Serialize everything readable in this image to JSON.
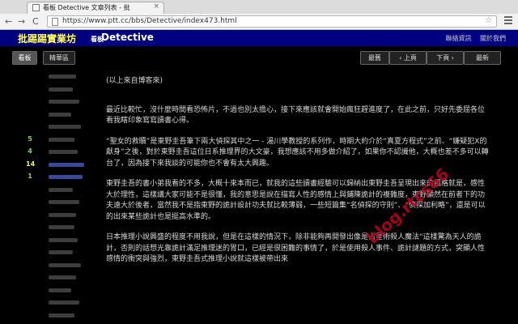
{
  "browser": {
    "tab_title": "看板 Detective 文章列表 - 批",
    "tab_close": "×",
    "url": "https://www.ptt.cc/bbs/Detective/index473.html",
    "back": "←",
    "forward": "→",
    "reload": "C",
    "star": "☆"
  },
  "header": {
    "site_name": "批踢踢實業坊",
    "board_label": "看板",
    "board_name": "Detective",
    "links": [
      "聯絡資訊",
      "關於我們"
    ]
  },
  "actions": {
    "board_tab": "看板",
    "digest_tab": "精華區",
    "oldest": "最舊",
    "prev": "‹ 上頁",
    "next": "下頁 ›",
    "newest": "最新"
  },
  "list": [
    {
      "push": "",
      "color": "#bbb",
      "w": 34
    },
    {
      "push": "",
      "color": "#bbb",
      "w": 30
    },
    {
      "push": "",
      "color": "#bbb",
      "w": 38
    },
    {
      "push": "",
      "color": "#bbb",
      "w": 28
    },
    {
      "push": "",
      "color": "#bbb",
      "w": 40
    },
    {
      "push": "5",
      "color": "#7fdc3c",
      "w": 32
    },
    {
      "push": "4",
      "color": "#7fdc3c",
      "w": 36
    },
    {
      "push": "14",
      "color": "#f5f55a",
      "w": 44,
      "blue": true
    },
    {
      "push": "1",
      "color": "#7fdc3c",
      "w": 42,
      "blue": true
    },
    {
      "push": "",
      "color": "#bbb",
      "w": 30
    },
    {
      "push": "",
      "color": "#bbb",
      "w": 38
    },
    {
      "push": "",
      "color": "#bbb",
      "w": 34
    },
    {
      "push": "",
      "color": "#bbb",
      "w": 32
    },
    {
      "push": "",
      "color": "#bbb",
      "w": 36
    },
    {
      "push": "",
      "color": "#bbb",
      "w": 30
    },
    {
      "push": "",
      "color": "#bbb",
      "w": 40
    },
    {
      "push": "",
      "color": "#bbb",
      "w": 34
    },
    {
      "push": "",
      "color": "#bbb",
      "w": 28
    },
    {
      "push": "",
      "color": "#bbb",
      "w": 38
    },
    {
      "push": "",
      "color": "#bbb",
      "w": 32
    }
  ],
  "content": {
    "paragraphs": [
      "(以上來自博客來)",
      "最近比較忙，沒什麼時間看恐怖片，不過也別太擔心，接下來應該就會開始瘋狂趕進度了，在此之前，只好先委屈各位看我瞎印象寫寫讀書心得。",
      "“聖女的救贖”是東野圭吾筆下兩大偵探其中之一 - 湯川學教授的系列作，時期大約介於“真夏方程式”之前、“嫌疑犯X的獻身”之後，對於東野圭吾這位日系推理界的大文豪，我想應該不用多做介紹了，如果你不認識他，大概也差不多可以轉台了，因為接下來我談的可能你也不會有太大興趣。",
      "東野圭吾的書小弟我看的不多，大概十來本而已，就我的這些讀書經驗可以歸納出東野圭吾呈現出來的風格就是，感性大於理性，這樣講大家可能不是很懂，我的意思是說在描寫人性的感情上與鋪陳詭計的複雜度，東野顯然在前者下的功夫遠大於後者，當然我不是指東野的詭計設計功夫就比較薄弱，一些短篇集“名偵探的守則”、“偵探加利略”，還是可以的出來某些詭計也是挺高水準的。",
      "日本推理小說興盛的程度不用我說，但是在這樣的情況下，除非能夠再開發出像是占星術殺人魔法“這樣驚為天人的詭計，否則的話想光靠詭計滿足推理迷的胃口，已經是很困難的事情了，於是使用殺人事件、詭計謎題的方式，突顯人性感情的衝突與強烈，東野圭吾式推理小說就這樣被帶出來"
    ]
  },
  "watermark": "blog.rtcs66"
}
